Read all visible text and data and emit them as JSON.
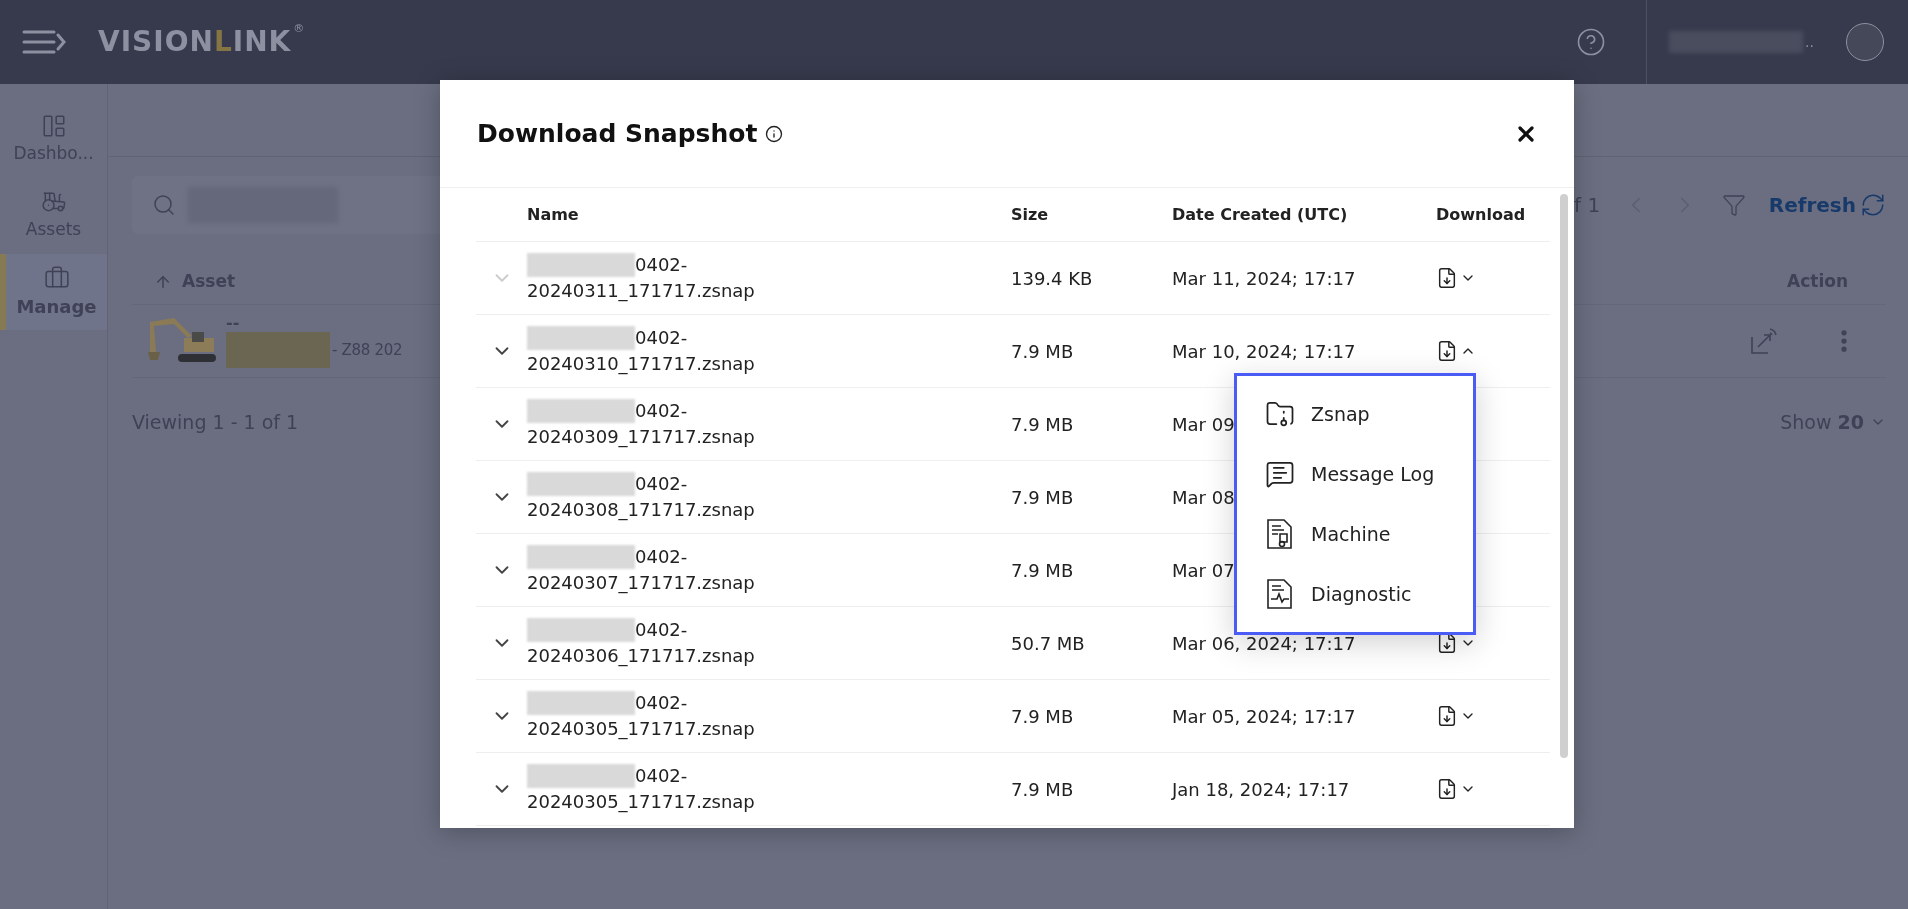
{
  "nav": {
    "logo": {
      "part_1": "VISION",
      "part_2": "L",
      "part_3": "INK",
      "mark": "®"
    },
    "user_suffix": ".."
  },
  "sidebar": {
    "items": [
      {
        "kind": "dashboard",
        "label": "Dashbo...",
        "selected": false
      },
      {
        "kind": "assets",
        "label": "Assets",
        "selected": false
      },
      {
        "kind": "manage",
        "label": "Manage",
        "selected": true
      }
    ]
  },
  "assets": {
    "sort_column": "Asset",
    "action_column": "Action",
    "pager": "f 1",
    "refresh": "Refresh",
    "rows": [
      {
        "line_1": "--",
        "line_2": "- Z88 202"
      }
    ],
    "footer": "Viewing 1 - 1 of 1",
    "page_size_label": "Show",
    "page_size": "20"
  },
  "dialog": {
    "title": "Download Snapshot",
    "columns": [
      "Name",
      "Size",
      "Date Created (UTC)",
      "Download"
    ],
    "rows": [
      {
        "name_1": "0402-",
        "name_2": "20240311_171717.zsnap",
        "size": "139.4 KB",
        "date": "Mar 11, 2024; 17:17",
        "disabled": true,
        "download": {
          "expanded": false
        }
      },
      {
        "name_1": "0402-",
        "name_2": "20240310_171717.zsnap",
        "size": "7.9 MB",
        "date": "Mar 10, 2024; 17:17",
        "disabled": false,
        "download": {
          "expanded": true
        }
      },
      {
        "name_1": "0402-",
        "name_2": "20240309_171717.zsnap",
        "size": "7.9 MB",
        "date": "Mar 09",
        "disabled": false
      },
      {
        "name_1": "0402-",
        "name_2": "20240308_171717.zsnap",
        "size": "7.9 MB",
        "date": "Mar 08",
        "disabled": false
      },
      {
        "name_1": "0402-",
        "name_2": "20240307_171717.zsnap",
        "size": "7.9 MB",
        "date": "Mar 07",
        "disabled": false
      },
      {
        "name_1": "0402-",
        "name_2": "20240306_171717.zsnap",
        "size": "50.7 MB",
        "date": "Mar 06, 2024; 17:17",
        "disabled": false,
        "download": {
          "expanded": false
        }
      },
      {
        "name_1": "0402-",
        "name_2": "20240305_171717.zsnap",
        "size": "7.9 MB",
        "date": "Mar 05, 2024; 17:17",
        "disabled": false,
        "download": {
          "expanded": false
        }
      },
      {
        "name_1": "0402-",
        "name_2": "20240305_171717.zsnap",
        "size": "7.9 MB",
        "date": "Jan 18, 2024; 17:17",
        "disabled": false,
        "download": {
          "expanded": false
        }
      }
    ],
    "menu": {
      "items": [
        {
          "kind": "zsnap",
          "label": "Zsnap"
        },
        {
          "kind": "message_log",
          "label": "Message Log"
        },
        {
          "kind": "machine",
          "label": "Machine"
        },
        {
          "kind": "diagnostic",
          "label": "Diagnostic"
        }
      ]
    }
  }
}
